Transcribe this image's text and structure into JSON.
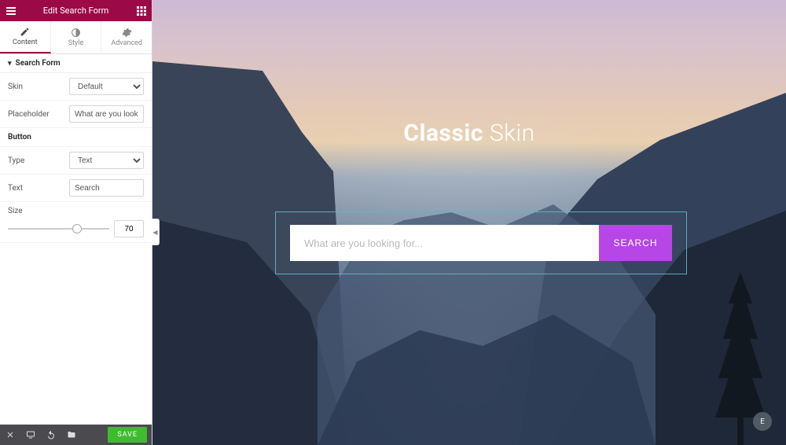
{
  "panel": {
    "title": "Edit Search Form",
    "tabs": {
      "content": "Content",
      "style": "Style",
      "advanced": "Advanced"
    },
    "section_title": "Search Form",
    "controls": {
      "skin_label": "Skin",
      "skin_value": "Default",
      "placeholder_label": "Placeholder",
      "placeholder_value": "What are you looking f",
      "button_subsection": "Button",
      "type_label": "Type",
      "type_value": "Text",
      "text_label": "Text",
      "text_value": "Search",
      "size_label": "Size",
      "size_value": "70"
    },
    "footer": {
      "save_label": "SAVE"
    }
  },
  "canvas": {
    "title_bold": "Classic",
    "title_light": "Skin",
    "search_placeholder": "What are you looking for...",
    "search_button": "SEARCH",
    "badge": "E"
  },
  "colors": {
    "accent_button": "#b646e6",
    "panel_header": "#9b0a46",
    "save_button": "#3fbb2f"
  }
}
